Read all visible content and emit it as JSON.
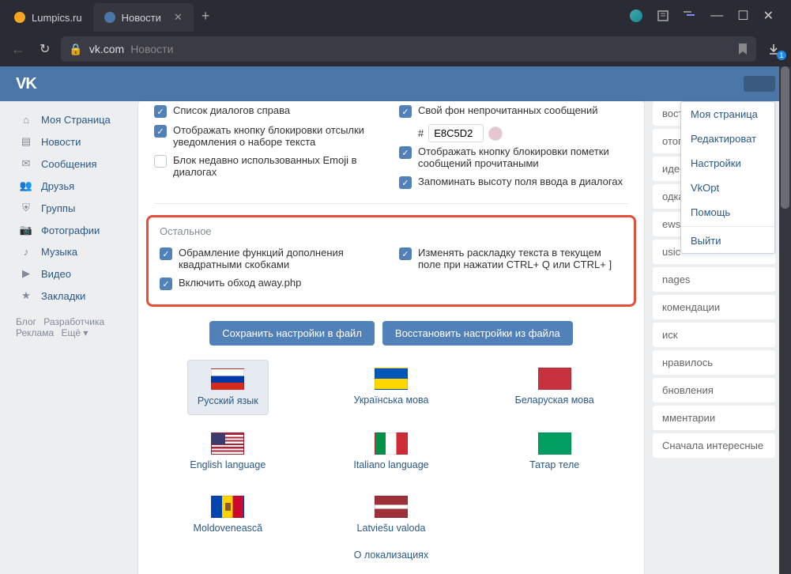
{
  "tabs": [
    {
      "label": "Lumpics.ru",
      "icon_color": "#f5a623"
    },
    {
      "label": "Новости",
      "icon_color": "#4a76a8"
    }
  ],
  "address": {
    "domain": "vk.com",
    "path": "Новости"
  },
  "download_badge": "1",
  "vk_logo": "VK",
  "sidebar": [
    {
      "icon": "⌂",
      "label": "Моя Страница"
    },
    {
      "icon": "▤",
      "label": "Новости"
    },
    {
      "icon": "✉",
      "label": "Сообщения"
    },
    {
      "icon": "👥",
      "label": "Друзья"
    },
    {
      "icon": "⛨",
      "label": "Группы"
    },
    {
      "icon": "📷",
      "label": "Фотографии"
    },
    {
      "icon": "♪",
      "label": "Музыка"
    },
    {
      "icon": "▶",
      "label": "Видео"
    },
    {
      "icon": "★",
      "label": "Закладки"
    }
  ],
  "sidebar_footer": {
    "a": "Блог",
    "b": "Разработчика",
    "c": "Реклама",
    "d": "Ещё ▾"
  },
  "right_tabs": [
    "вости",
    "отогра",
    "идеоза",
    "одкас",
    "ews",
    "usic",
    "nages",
    "комендации",
    "иск",
    "нравилось",
    "бновления",
    "мментарии",
    "Сначала интересные"
  ],
  "dropdown": [
    "Моя страница",
    "Редактироват",
    "Настройки",
    "VkOpt",
    "Помощь",
    "Выйти"
  ],
  "modal": {
    "top_left": [
      {
        "checked": true,
        "label": "Список диалогов справа"
      },
      {
        "checked": true,
        "label": "Отображать кнопку блокировки отсылки уведомления о наборе текста"
      },
      {
        "checked": false,
        "label": "Блок недавно использованных Emoji в диалогах"
      }
    ],
    "top_right": [
      {
        "checked": true,
        "label": "Свой фон непрочитанных сообщений"
      },
      {
        "checked": true,
        "label": "Отображать кнопку блокировки пометки сообщений прочитаными"
      },
      {
        "checked": true,
        "label": "Запоминать высоту поля ввода в диалогах"
      }
    ],
    "color_hash": "#",
    "color_value": "E8C5D2",
    "section_title": "Остальное",
    "other_left": [
      {
        "label": "Обрамление функций дополнения квадратными скобками"
      },
      {
        "label": "Включить обход away.php"
      }
    ],
    "other_right": [
      {
        "label": "Изменять раскладку текста в текущем поле при нажатии CTRL+ Q или CTRL+ ]"
      }
    ],
    "btn_save": "Сохранить настройки в файл",
    "btn_restore": "Восстановить настройки из файла",
    "languages": [
      {
        "label": "Русский язык",
        "flag": "ru",
        "active": true
      },
      {
        "label": "Українська мова",
        "flag": "ua"
      },
      {
        "label": "Беларуская мова",
        "flag": "by"
      },
      {
        "label": "English language",
        "flag": "en"
      },
      {
        "label": "Italiano language",
        "flag": "it"
      },
      {
        "label": "Татар теле",
        "flag": "tt"
      },
      {
        "label": "Moldovenească",
        "flag": "md"
      },
      {
        "label": "Latviešu valoda",
        "flag": "lv"
      }
    ],
    "about_locales": "О локализациях"
  }
}
